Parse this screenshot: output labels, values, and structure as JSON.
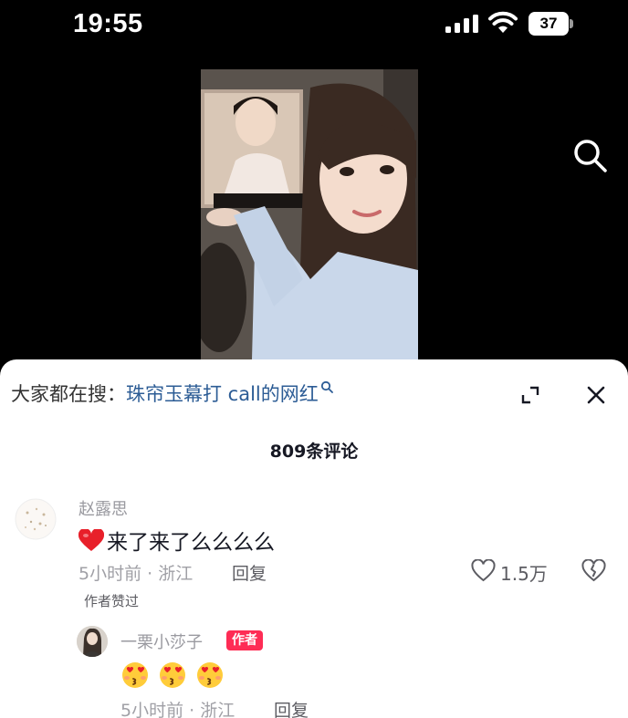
{
  "status_bar": {
    "time": "19:55",
    "battery": "37"
  },
  "video": {
    "search_icon": "search-icon"
  },
  "panel": {
    "hot_search_prefix": "大家都在搜：",
    "hot_search_term": "珠帘玉幕打 call的网红",
    "comment_count": "809条评论",
    "icons": {
      "expand": "expand-icon",
      "close": "close-icon"
    }
  },
  "comments": [
    {
      "username": "赵露思",
      "text": "来了来了么么么么",
      "time_location": "5小时前 · 浙江",
      "reply_label": "回复",
      "likes": "1.5万",
      "author_liked": "作者赞过",
      "replies": [
        {
          "username": "一栗小莎子",
          "badge": "作者",
          "text_emojis": [
            "kiss-heart-eyes-emoji",
            "kiss-heart-eyes-emoji",
            "kiss-heart-eyes-emoji"
          ],
          "time_location": "5小时前 · 浙江",
          "reply_label": "回复"
        }
      ]
    }
  ],
  "colors": {
    "accent_red": "#fe2c55",
    "search_term_blue": "#2c5c95",
    "text_primary": "#161823",
    "text_secondary": "#a0a0a6"
  }
}
